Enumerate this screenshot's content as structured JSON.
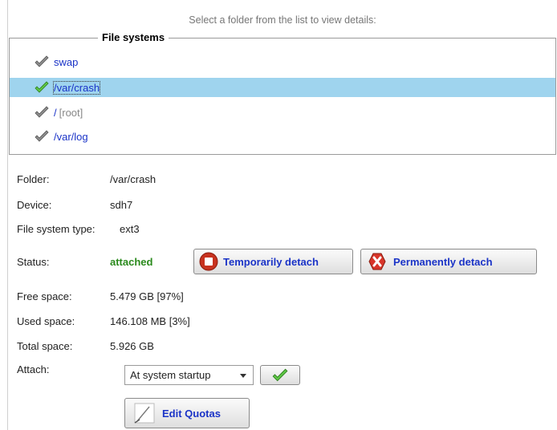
{
  "hint": "Select a folder from the list to view details:",
  "filesystems": {
    "legend": "File systems",
    "items": [
      {
        "label": "swap",
        "suffix": ""
      },
      {
        "label": "/var/crash",
        "suffix": ""
      },
      {
        "label": "/",
        "suffix": "[root]"
      },
      {
        "label": "/var/log",
        "suffix": ""
      }
    ],
    "selected_index": 1
  },
  "details": {
    "folder_label": "Folder:",
    "folder_value": "/var/crash",
    "device_label": "Device:",
    "device_value": "sdh7",
    "fstype_label": "File system type:",
    "fstype_value": "ext3",
    "status_label": "Status:",
    "status_value": "attached",
    "free_label": "Free space:",
    "free_value": "5.479 GB [97%]",
    "used_label": "Used space:",
    "used_value": "146.108 MB [3%]",
    "total_label": "Total space:",
    "total_value": "5.926 GB",
    "attach_label": "Attach:",
    "attach_value": "At system startup"
  },
  "buttons": {
    "temp_detach": "Temporarily detach",
    "perm_detach": "Permanently detach",
    "edit_quotas": "Edit Quotas"
  },
  "icons": {
    "check": "checkmark-icon",
    "stop": "stop-icon",
    "remove": "remove-icon",
    "edit": "pencil-icon"
  },
  "colors": {
    "link": "#1a33c7",
    "selected_row": "#9fd4ee",
    "status_ok": "#2a8a1c"
  }
}
